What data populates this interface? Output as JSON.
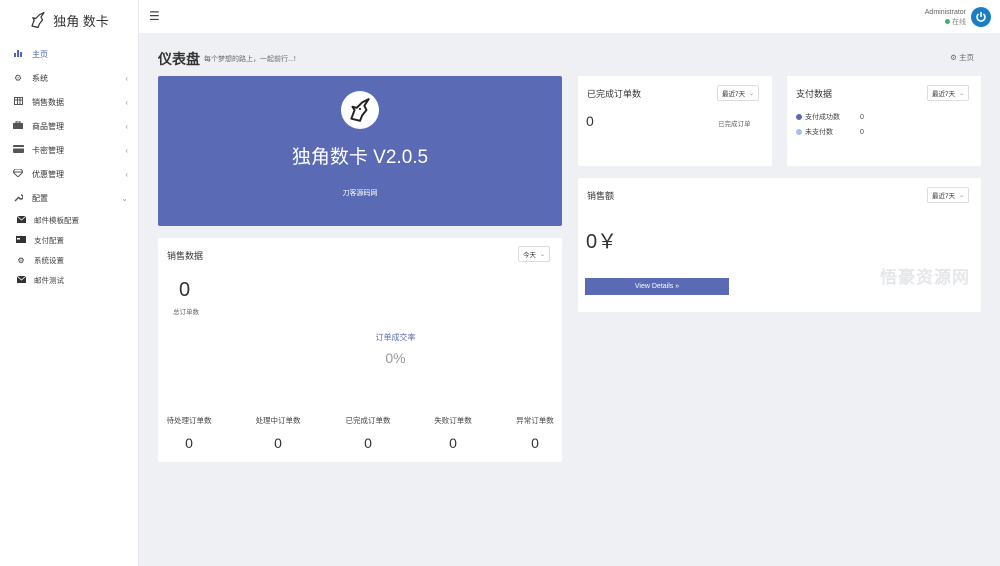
{
  "brand": {
    "name": "独角 数卡"
  },
  "sidebar": {
    "items": [
      {
        "label": "主页",
        "icon": "bar-chart-icon",
        "active": true
      },
      {
        "label": "系统",
        "icon": "gear-icon"
      },
      {
        "label": "销售数据",
        "icon": "table-icon"
      },
      {
        "label": "商品管理",
        "icon": "briefcase-icon"
      },
      {
        "label": "卡密管理",
        "icon": "credit-card-icon"
      },
      {
        "label": "优惠管理",
        "icon": "diamond-icon"
      },
      {
        "label": "配置",
        "icon": "wrench-icon",
        "expanded": true
      }
    ],
    "sub_items": [
      {
        "label": "邮件模板配置",
        "icon": "envelope-icon"
      },
      {
        "label": "支付配置",
        "icon": "card-icon"
      },
      {
        "label": "系统设置",
        "icon": "cogs-icon"
      },
      {
        "label": "邮件测试",
        "icon": "envelope-icon"
      }
    ]
  },
  "header": {
    "menu_icon": "hamburger-icon",
    "user_name": "Administrator",
    "user_status": "在线",
    "status_color": "#3cb371",
    "avatar_color": "#1a7ec7"
  },
  "page": {
    "title": "仪表盘",
    "subtitle": "每个梦想的路上，一起前行...!",
    "breadcrumb": "主页"
  },
  "hero": {
    "title": "独角数卡 V2.0.5",
    "subtitle": "刀客源码网",
    "color": "#5a6ab5"
  },
  "completed_orders": {
    "title": "已完成订单数",
    "filter": "最近7天",
    "value": "0",
    "label": "已完成订单"
  },
  "payment": {
    "title": "支付数据",
    "filter": "最近7天",
    "rows": [
      {
        "label": "支付成功数",
        "value": "0",
        "color": "#5a6ab5"
      },
      {
        "label": "未支付数",
        "value": "0",
        "color": "#9ec3ea"
      }
    ]
  },
  "sales_amount": {
    "title": "销售额",
    "filter": "最近7天",
    "value": "0￥",
    "button": "View Details"
  },
  "sales": {
    "title": "销售数据",
    "filter": "今天",
    "total_value": "0",
    "total_label": "总订单数",
    "rate_label": "订单成交率",
    "rate_value": "0%",
    "stats": [
      {
        "label": "待处理订单数",
        "value": "0"
      },
      {
        "label": "处理中订单数",
        "value": "0"
      },
      {
        "label": "已完成订单数",
        "value": "0"
      },
      {
        "label": "失败订单数",
        "value": "0"
      },
      {
        "label": "异常订单数",
        "value": "0"
      }
    ]
  },
  "watermark": "悟豪资源网"
}
